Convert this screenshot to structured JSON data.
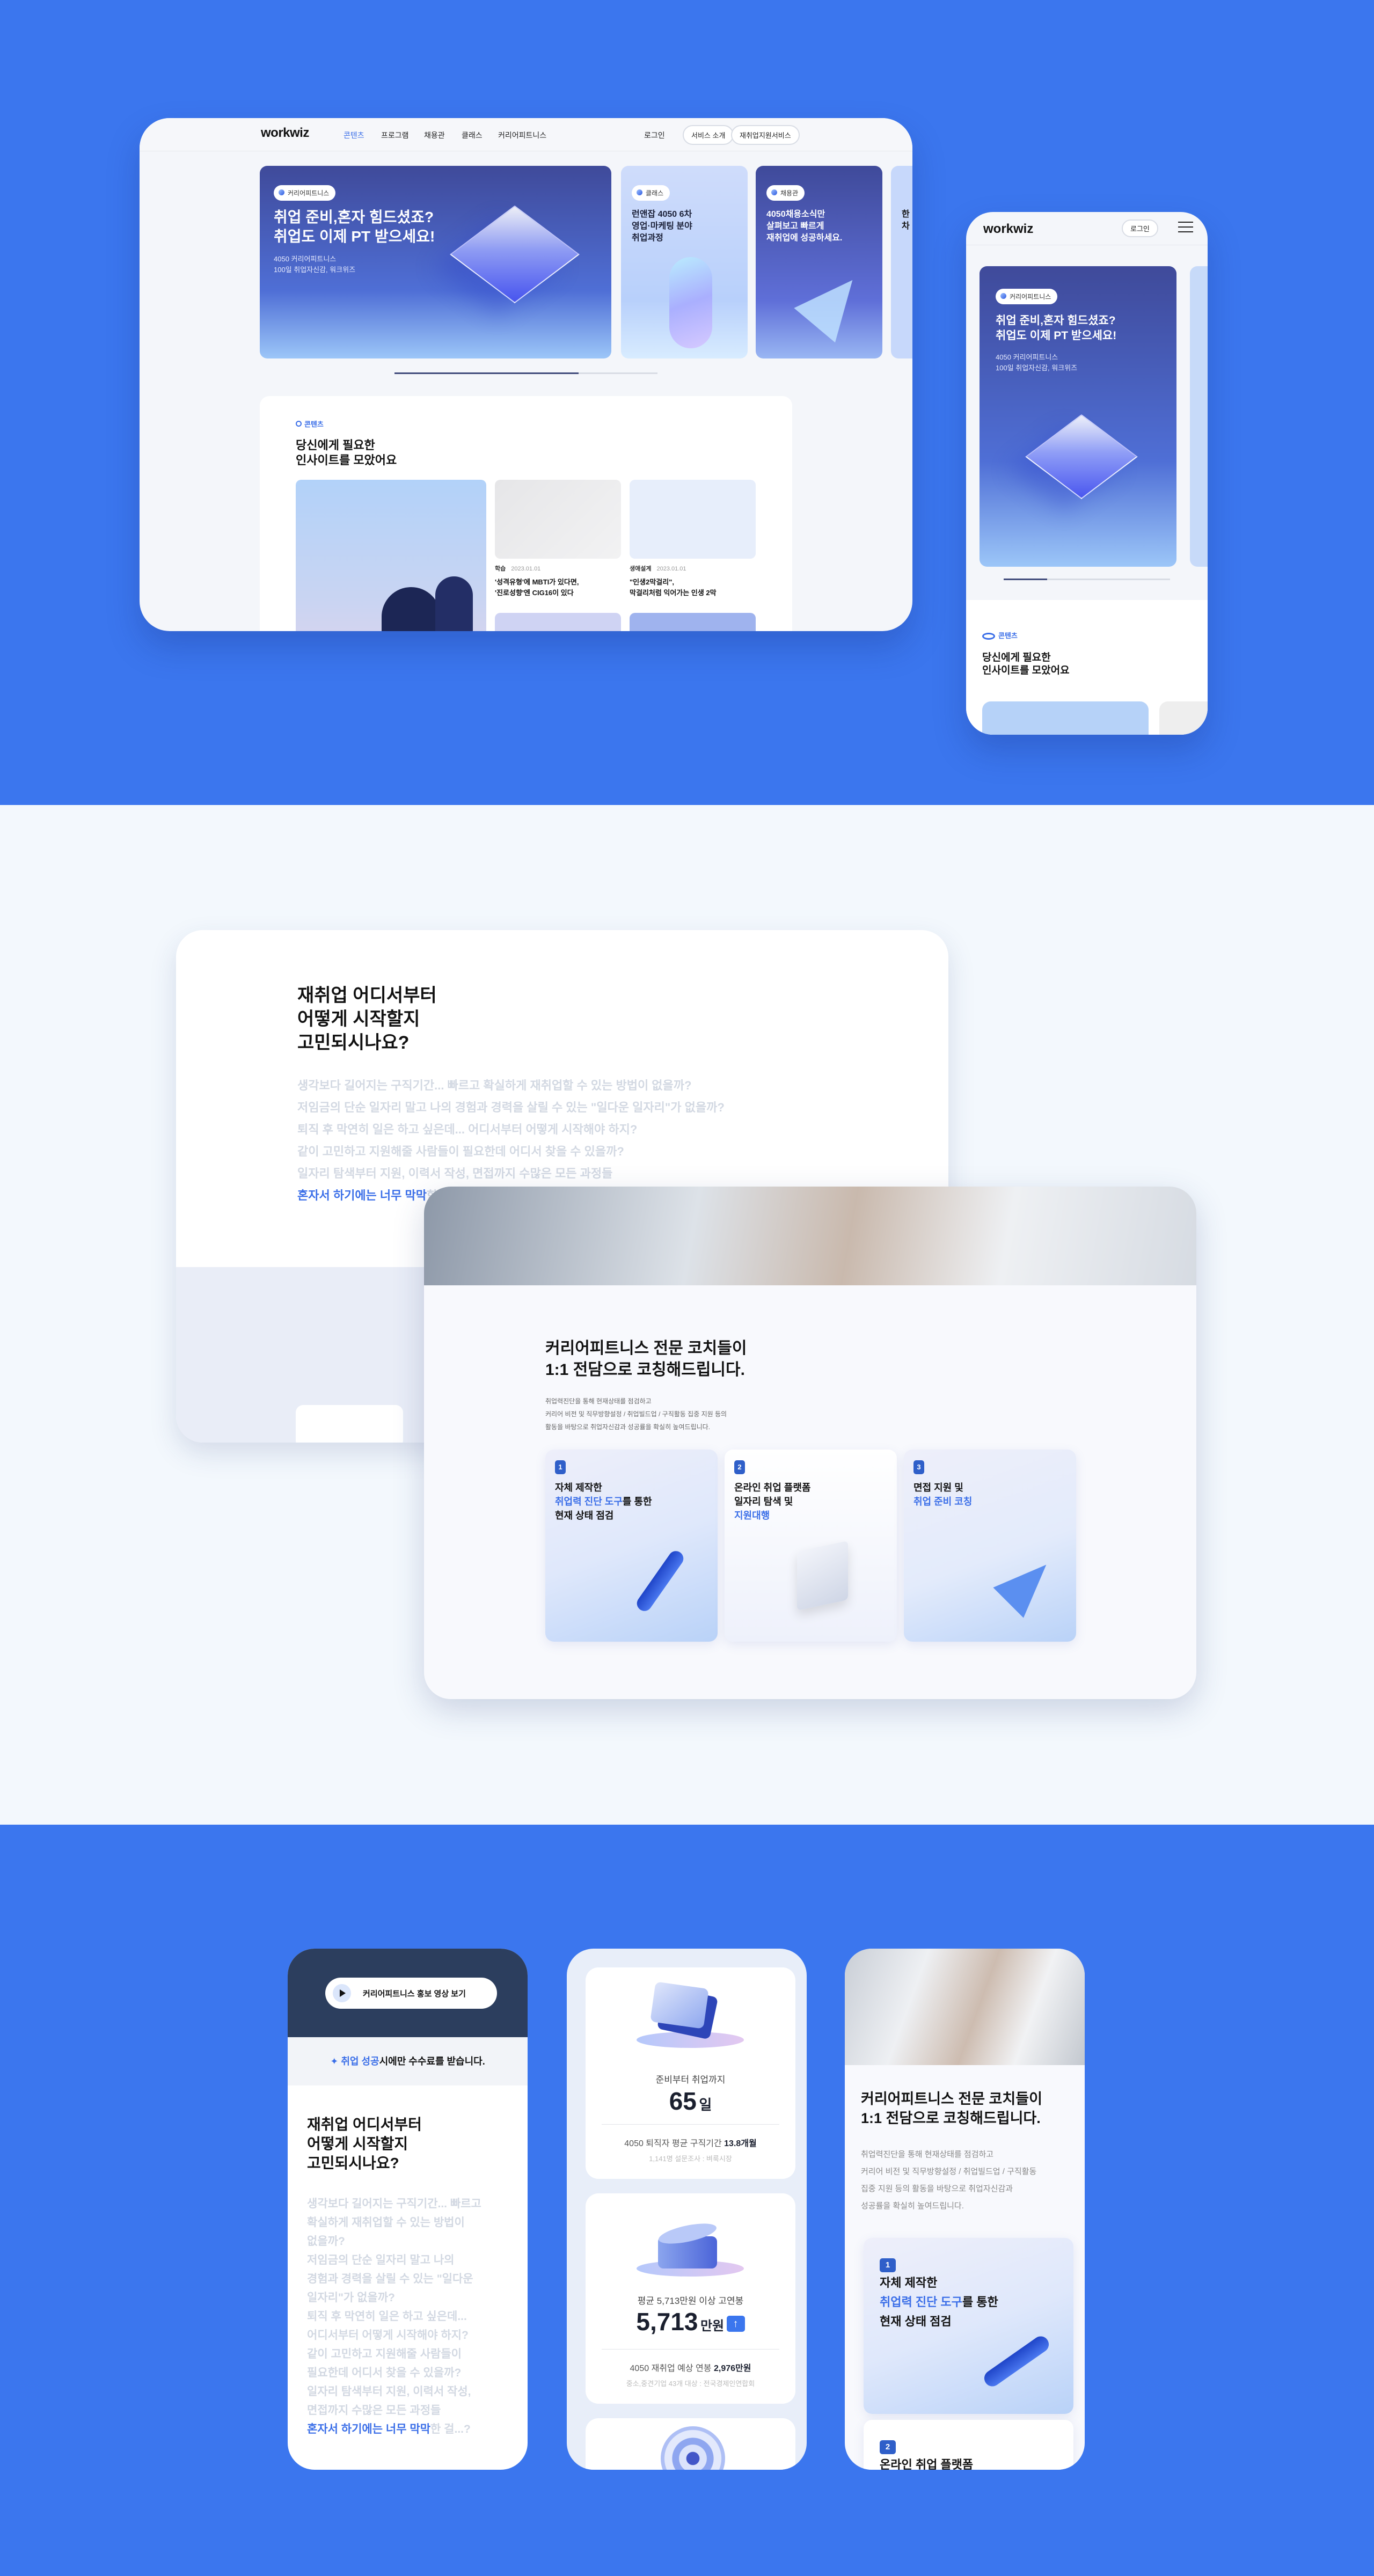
{
  "colors": {
    "brand_blue": "#3b76ee",
    "accent": "#3a6ee8",
    "hero_dark": "#3f4a9a",
    "badge_blue": "#2f5fc9"
  },
  "desktop": {
    "nav": {
      "logo": "workwiz",
      "links": [
        "콘텐츠",
        "프로그램",
        "채용관",
        "클래스",
        "커리어피트니스"
      ],
      "active_link": "콘텐츠",
      "login": "로그인",
      "service_intro": "서비스 소개",
      "reemployment": "재취업지원서비스"
    },
    "hero_cards": [
      {
        "badge": "커리어피트니스",
        "title": [
          "취업 준비,혼자 힘드셨죠?",
          "취업도 이제 PT 받으세요!"
        ],
        "sub": [
          "4050 커리어피트니스",
          "100일 취업자신감, 워크위즈"
        ]
      },
      {
        "badge": "클래스",
        "title": [
          "런앤잡 4050 6차",
          "영업·마케팅 분야",
          "취업과정"
        ]
      },
      {
        "badge": "채용관",
        "title": [
          "4050채용소식만",
          "살펴보고 빠르게",
          "재취업에 성공하세요."
        ]
      },
      {
        "title": [
          "한",
          "차"
        ]
      }
    ],
    "carousel_progress": 0.7,
    "content": {
      "label": "콘텐츠",
      "title": [
        "당신에게 필요한",
        "인사이트를 모았어요"
      ],
      "articles": [
        {
          "category": "학습",
          "date": "2023.01.01",
          "title": [
            "'성격유형'에 MBTI가 있다면,",
            "'진로성향'엔 CIG16이 있다"
          ]
        },
        {
          "category": "생애설계",
          "date": "2023.01.01",
          "title": [
            "\"인생2막걸리\",",
            "막걸리처럼 익어가는 인생 2막"
          ]
        }
      ]
    }
  },
  "mobile": {
    "logo": "workwiz",
    "login": "로그인",
    "menu_icon": "hamburger-icon",
    "hero": {
      "badge": "커리어피트니스",
      "title": [
        "취업 준비,혼자 힘드셨죠?",
        "취업도 이제 PT 받으세요!"
      ],
      "sub": [
        "4050 커리어피트니스",
        "100일 취업자신감, 워크위즈"
      ]
    },
    "carousel_progress": 0.26,
    "content": {
      "label": "콘텐츠",
      "title": [
        "당신에게 필요한",
        "인사이트를 모았어요"
      ]
    }
  },
  "problem": {
    "title": [
      "재취업 어디서부터",
      "어떻게 시작할지",
      "고민되시나요?"
    ],
    "questions": [
      "생각보다 길어지는 구직기간... 빠르고 확실하게 재취업할 수 있는 방법이 없을까?",
      "저임금의 단순 일자리 말고 나의 경험과 경력을 살릴 수 있는 \"일다운 일자리\"가 없을까?",
      "퇴직 후 막연히 일은 하고 싶은데... 어디서부터 어떻게 시작해야 하지?",
      "같이 고민하고 지원해줄 사람들이 필요한데 어디서 찾을 수 있을까?",
      "일자리 탐색부터 지원, 이력서 작성, 면접까지 수많은 모든 과정들"
    ],
    "highlight": "혼자서 하기에는 너무 막막",
    "highlight_rest": "한 걸...?",
    "mobile_questions": [
      "생각보다 길어지는 구직기간... 빠르고",
      "확실하게 재취업할 수 있는 방법이",
      "없을까?",
      "저임금의 단순 일자리 말고 나의",
      "경험과 경력을 살릴 수 있는 \"일다운",
      "일자리\"가 없을까?",
      "퇴직 후 막연히 일은 하고 싶은데...",
      "어디서부터 어떻게 시작해야 하지?",
      "같이 고민하고 지원해줄 사람들이",
      "필요한데 어디서 찾을 수 있을까?",
      "일자리 탐색부터 지원, 이력서 작성,",
      "면접까지 수많은 모든 과정들"
    ]
  },
  "coaching": {
    "title": [
      "커리어피트니스 전문 코치들이",
      "1:1 전담으로 코칭해드립니다."
    ],
    "desc": [
      "취업력진단을 통해 현재상태를 점검하고",
      "커리어 비전 및 직무방향설정 / 취업빌드업 / 구직활동 집중 지원 등의",
      "활동을 바탕으로 취업자신감과 성공률을 확실히 높여드립니다."
    ],
    "desc_mobile": [
      "취업력진단을 통해 현재상태를 점검하고",
      "커리어 비전 및 직무방향설정 / 취업빌드업 / 구직활동",
      "집중 지원 등의 활동을 바탕으로 취업자신감과",
      "성공률을 확실히 높여드립니다."
    ],
    "steps": [
      {
        "num": "1",
        "l1": "자체 제작한",
        "l2_blue": "취업력 진단 도구",
        "l2_rest": "를 통한",
        "l3": "현재 상태 점검"
      },
      {
        "num": "2",
        "l1": "온라인 취업 플랫폼",
        "l2": "일자리 탐색 및",
        "l3_blue": "지원대행"
      },
      {
        "num": "3",
        "l1": "면접 지원 및",
        "l2_blue": "취업 준비 코칭"
      }
    ]
  },
  "phone1": {
    "video_button": "커리어피트니스 홍보 영상 보기",
    "fee_highlight": "취업 성공",
    "fee_rest": "시에만 수수료를 받습니다."
  },
  "stats": [
    {
      "label": "준비부터 취업까지",
      "value": "65",
      "unit": "일",
      "compare": "4050 퇴직자 평균 구직기간",
      "compare_value": "13.8개월",
      "source": "1,141명 설문조사 : 벼룩시장"
    },
    {
      "label": "평균 5,713만원 이상 고연봉",
      "value": "5,713",
      "unit": "만원",
      "trend": "up",
      "compare": "4050 재취업 예상 연봉",
      "compare_value": "2,976만원",
      "source": "중소,중견기업 43개 대상 : 전국경제인연합회"
    }
  ]
}
